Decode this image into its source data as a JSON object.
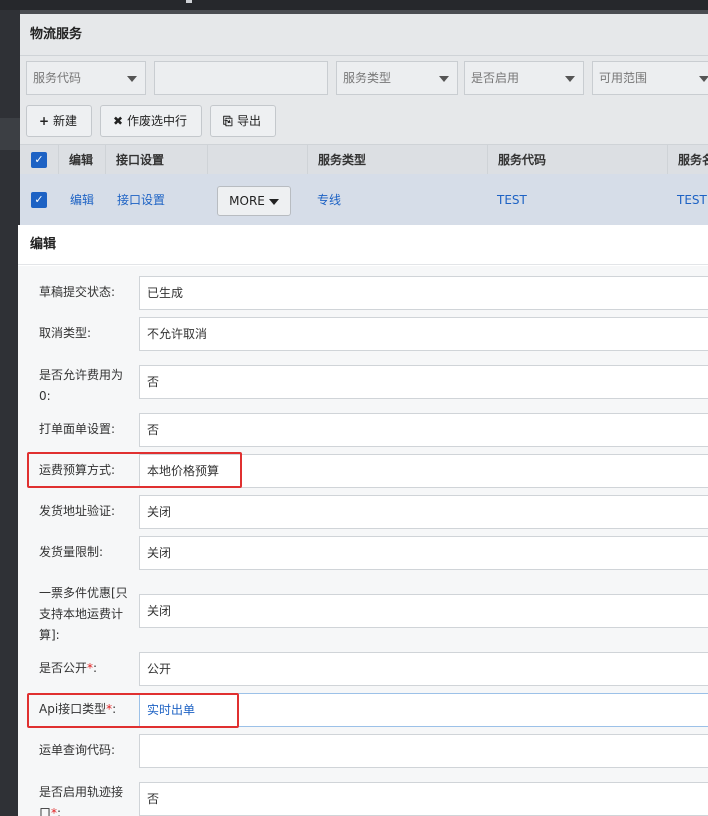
{
  "list": {
    "title": "物流服务",
    "filters": {
      "service_code": "服务代码",
      "search": "",
      "service_type": "服务类型",
      "enabled": "是否启用",
      "range": "可用范围"
    },
    "actions": {
      "new_label": "新建",
      "void_label": "作废选中行",
      "export_label": "导出"
    },
    "columns": [
      "编辑",
      "接口设置",
      "",
      "服务类型",
      "服务代码",
      "服务名"
    ],
    "row": {
      "edit": "编辑",
      "interface": "接口设置",
      "more": "MORE",
      "type": "专线",
      "code": "TEST",
      "name": "TEST"
    }
  },
  "modal": {
    "title": "编辑",
    "fields": [
      {
        "label": "草稿提交状态:",
        "value": "已生成",
        "required": false
      },
      {
        "label": "取消类型:",
        "value": "不允许取消",
        "required": false
      },
      {
        "label": "是否允许费用为0:",
        "value": "否",
        "required": false
      },
      {
        "label": "打单面单设置:",
        "value": "否",
        "required": false
      },
      {
        "label": "运费预算方式:",
        "value": "本地价格预算",
        "required": false
      },
      {
        "label": "发货地址验证:",
        "value": "关闭",
        "required": false
      },
      {
        "label": "发货量限制:",
        "value": "关闭",
        "required": false
      },
      {
        "label": "一票多件优惠[只支持本地运费计算]:",
        "value": "关闭",
        "required": false
      },
      {
        "label": "是否公开",
        "value": "公开",
        "required": true
      },
      {
        "label": "Api接口类型",
        "value": "实时出单",
        "required": true
      },
      {
        "label": "运单查询代码:",
        "value": "",
        "required": false
      },
      {
        "label": "是否启用轨迹接口",
        "value": "否",
        "required": true
      }
    ]
  },
  "colors": {
    "link": "#1d62c4",
    "highlight": "#e03030",
    "required": "#e02020"
  }
}
